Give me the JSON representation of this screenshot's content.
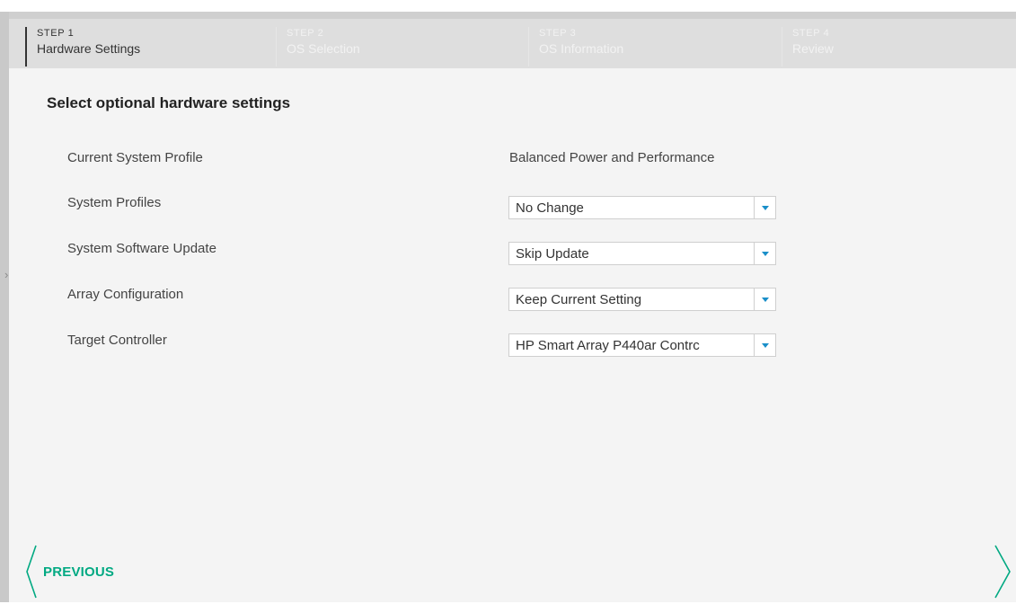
{
  "steps": [
    {
      "number": "STEP 1",
      "name": "Hardware Settings",
      "active": true
    },
    {
      "number": "STEP 2",
      "name": "OS Selection",
      "active": false
    },
    {
      "number": "STEP 3",
      "name": "OS Information",
      "active": false
    },
    {
      "number": "STEP 4",
      "name": "Review",
      "active": false
    }
  ],
  "section_title": "Select optional hardware settings",
  "form": {
    "current_profile_label": "Current System Profile",
    "current_profile_value": "Balanced Power and Performance",
    "system_profiles_label": "System Profiles",
    "system_profiles_value": "No Change",
    "software_update_label": "System Software Update",
    "software_update_value": "Skip Update",
    "array_config_label": "Array Configuration",
    "array_config_value": "Keep Current Setting",
    "target_controller_label": "Target Controller",
    "target_controller_value": "HP Smart Array P440ar Contrc"
  },
  "nav": {
    "previous_label": "PREVIOUS"
  },
  "icons": {
    "dropdown": "chevron-down-icon",
    "previous": "chevron-left-icon",
    "next": "chevron-right-icon"
  },
  "colors": {
    "accent": "#01a982",
    "dropdown_arrow": "#1a8fc9"
  }
}
